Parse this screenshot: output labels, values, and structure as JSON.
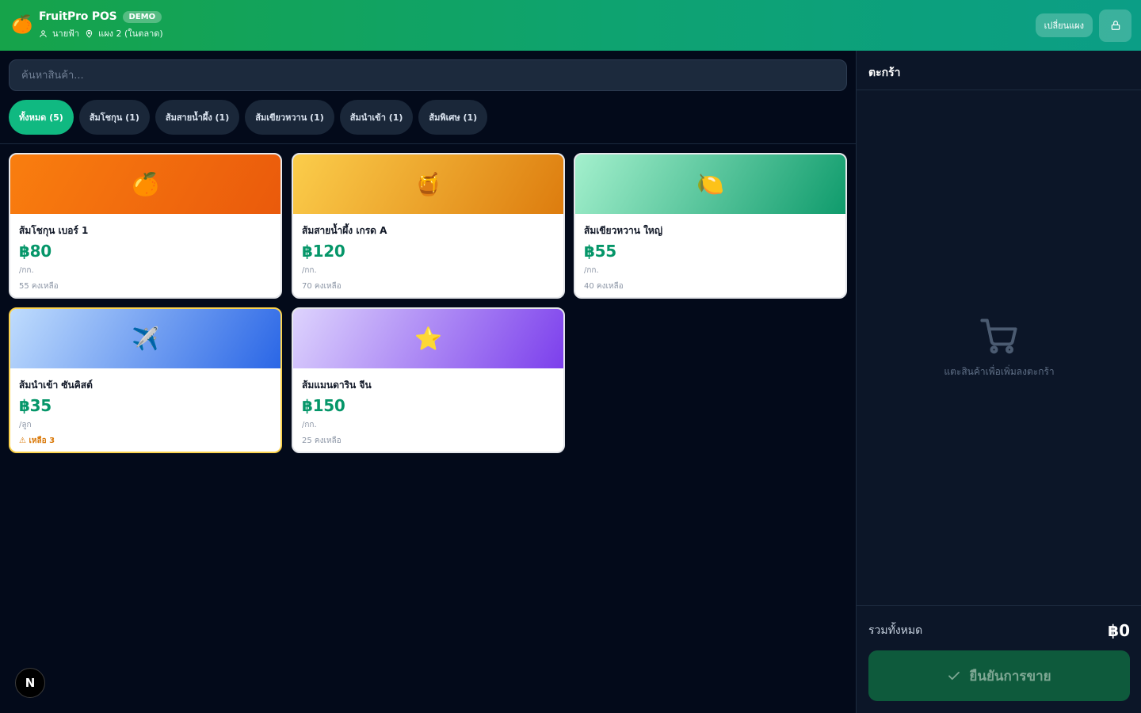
{
  "header": {
    "logo_emoji": "🍊",
    "title": "FruitPro POS",
    "badge": "DEMO",
    "user": "นายฟ้า",
    "location": "แผง 2 (ในตลาด)",
    "switch_label": "เปลี่ยนแผง",
    "icons": {
      "user": "user-icon",
      "location": "map-pin-icon",
      "lock": "lock-icon"
    }
  },
  "search": {
    "placeholder": "ค้นหาสินค้า...",
    "value": ""
  },
  "categories": [
    {
      "label": "ทั้งหมด (5)",
      "active": true
    },
    {
      "label": "ส้มโชกุน (1)",
      "active": false
    },
    {
      "label": "ส้มสายน้ำผึ้ง (1)",
      "active": false
    },
    {
      "label": "ส้มเขียวหวาน (1)",
      "active": false
    },
    {
      "label": "ส้มนำเข้า (1)",
      "active": false
    },
    {
      "label": "ส้มพิเศษ (1)",
      "active": false
    }
  ],
  "products": [
    {
      "emoji": "🍊",
      "name": "ส้มโชกุน เบอร์ 1",
      "price": "฿80",
      "unit": "/กก.",
      "stock": "55 คงเหลือ",
      "low_stock": false,
      "gradient": [
        "#f97e0f",
        "#ea5a0c"
      ]
    },
    {
      "emoji": "🍯",
      "name": "ส้มสายน้ำผึ้ง เกรด A",
      "price": "฿120",
      "unit": "/กก.",
      "stock": "70 คงเหลือ",
      "low_stock": false,
      "gradient": [
        "#fbcd4b",
        "#dd7c0e"
      ]
    },
    {
      "emoji": "🍋",
      "name": "ส้มเขียวหวาน ใหญ่",
      "price": "฿55",
      "unit": "/กก.",
      "stock": "40 คงเหลือ",
      "low_stock": false,
      "gradient": [
        "#a4f0cd",
        "#0f9b6c"
      ]
    },
    {
      "emoji": "✈️",
      "name": "ส้มนำเข้า ซันคิสต์",
      "price": "฿35",
      "unit": "/ลูก",
      "stock": "⚠ เหลือ 3",
      "low_stock": true,
      "gradient": [
        "#bfdcfd",
        "#2a66e6"
      ]
    },
    {
      "emoji": "⭐",
      "name": "ส้มแมนดาริน จีน",
      "price": "฿150",
      "unit": "/กก.",
      "stock": "25 คงเหลือ",
      "low_stock": false,
      "gradient": [
        "#ddd3fd",
        "#7c3fec"
      ]
    }
  ],
  "cart": {
    "title": "ตะกร้า",
    "empty_icon": "shopping-cart-icon",
    "empty_text": "แตะสินค้าเพื่อเพิ่มลงตะกร้า",
    "total_label": "รวมทั้งหมด",
    "total_value": "฿0",
    "confirm_label": "ยืนยันการขาย",
    "confirm_icon": "check-icon"
  },
  "floating_badge": "N",
  "colors": {
    "accent": "#10b981",
    "price": "#059669",
    "warning": "#d97706",
    "background": "#030a1a",
    "panel": "#0c1628"
  }
}
